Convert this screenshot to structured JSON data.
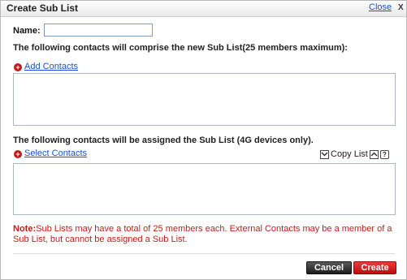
{
  "dialog": {
    "title": "Create Sub List",
    "close_label": "Close",
    "close_x": "X"
  },
  "form": {
    "name_label": "Name:",
    "name_value": "",
    "members_text": "The following contacts will comprise the new Sub List(25 members maximum):",
    "add_contacts_label": "Add Contacts",
    "assign_text": "The following contacts will be assigned the Sub List (4G devices only).",
    "select_contacts_label": "Select Contacts",
    "copy_list_label": "Copy List",
    "help_label": "?"
  },
  "note": {
    "prefix": "Note:",
    "text": "Sub Lists may have a total of 25 members each. External Contacts may be a member of a Sub List, but cannot be assigned a Sub List."
  },
  "buttons": {
    "cancel_label": "Cancel",
    "create_label": "Create"
  },
  "colors": {
    "accent_red": "#d11818",
    "link_blue": "#1a4fd1"
  },
  "icons": [
    "plus-circle-icon",
    "copy-down-icon",
    "copy-up-icon",
    "help-icon"
  ]
}
